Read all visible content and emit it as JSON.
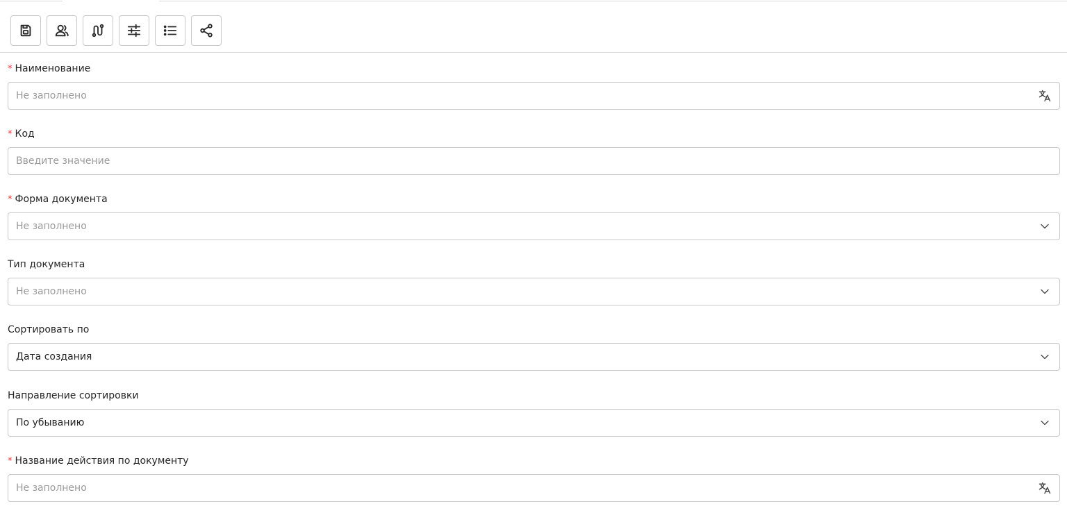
{
  "toolbar": {
    "buttons": [
      {
        "icon": "save-icon"
      },
      {
        "icon": "users-icon"
      },
      {
        "icon": "route-icon"
      },
      {
        "icon": "sliders-icon"
      },
      {
        "icon": "list-icon"
      },
      {
        "icon": "share-icon"
      }
    ]
  },
  "form": {
    "name": {
      "label": "Наименование",
      "required": true,
      "placeholder": "Не заполнено",
      "suffix_icon": "translate-icon"
    },
    "code": {
      "label": "Код",
      "required": true,
      "placeholder": "Введите значение"
    },
    "doc_form": {
      "label": "Форма документа",
      "required": true,
      "placeholder": "Не заполнено",
      "suffix_icon": "chevron-down-icon"
    },
    "doc_type": {
      "label": "Тип документа",
      "required": false,
      "placeholder": "Не заполнено",
      "suffix_icon": "chevron-down-icon"
    },
    "sort_by": {
      "label": "Сортировать по",
      "required": false,
      "value": "Дата создания",
      "suffix_icon": "chevron-down-icon"
    },
    "sort_dir": {
      "label": "Направление сортировки",
      "required": false,
      "value": "По убыванию",
      "suffix_icon": "chevron-down-icon"
    },
    "action_name": {
      "label": "Название действия по документу",
      "required": true,
      "placeholder": "Не заполнено",
      "suffix_icon": "translate-icon"
    }
  },
  "colors": {
    "required": "#e53935",
    "border": "#c8c8c8",
    "placeholder": "#9a9a9a"
  }
}
